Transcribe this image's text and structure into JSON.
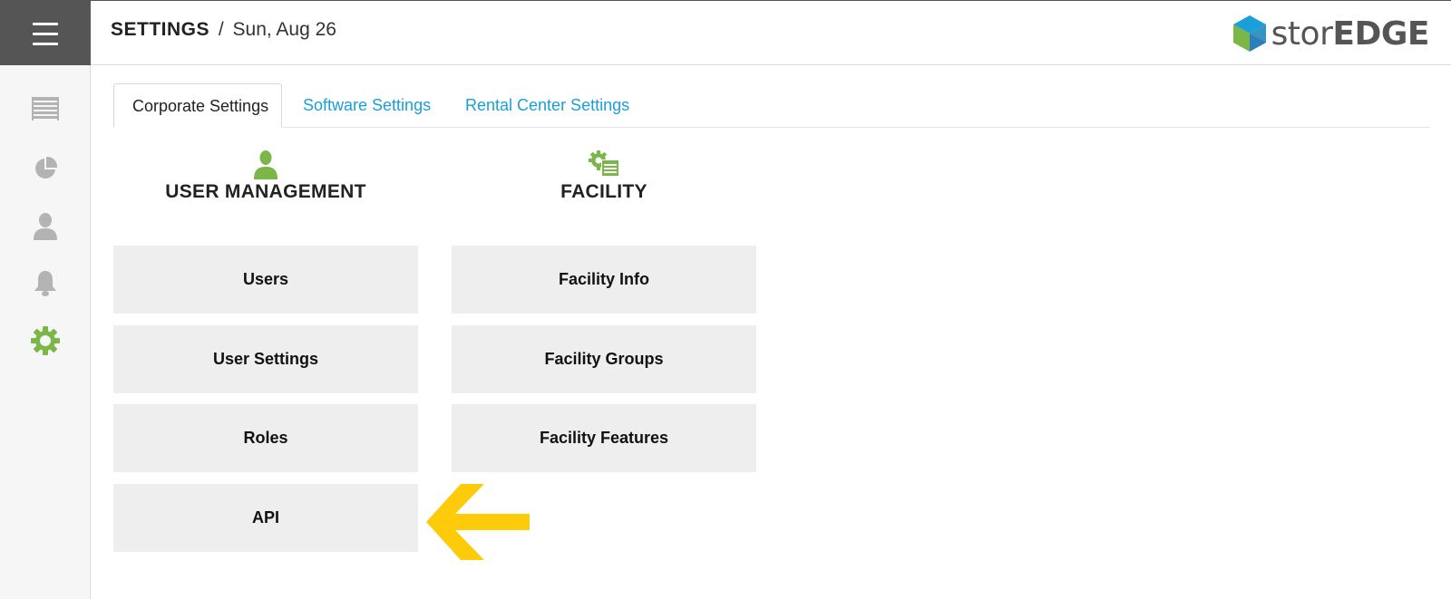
{
  "header": {
    "title": "SETTINGS",
    "separator": "/",
    "date": "Sun, Aug 26",
    "logo": {
      "part1": "stor",
      "part2": "EDGE"
    }
  },
  "sidebar": {
    "items": [
      {
        "name": "storage-unit-icon"
      },
      {
        "name": "pie-chart-icon"
      },
      {
        "name": "user-icon"
      },
      {
        "name": "bell-icon"
      },
      {
        "name": "gear-icon",
        "active": true
      }
    ]
  },
  "tabs": [
    {
      "label": "Corporate Settings",
      "active": true
    },
    {
      "label": "Software Settings",
      "active": false
    },
    {
      "label": "Rental Center Settings",
      "active": false
    }
  ],
  "sections": {
    "user_management": {
      "title": "USER MANAGEMENT",
      "icon": "user-icon",
      "items": [
        "Users",
        "User Settings",
        "Roles",
        "API"
      ]
    },
    "facility": {
      "title": "FACILITY",
      "icon": "facility-gear-icon",
      "items": [
        "Facility Info",
        "Facility Groups",
        "Facility Features"
      ]
    }
  },
  "colors": {
    "accent_green": "#7ab648",
    "link_blue": "#1a9fd6",
    "arrow_yellow": "#fdcb0a",
    "sidebar_icon_gray": "#b3b3b3",
    "menu_bg": "#555555"
  }
}
